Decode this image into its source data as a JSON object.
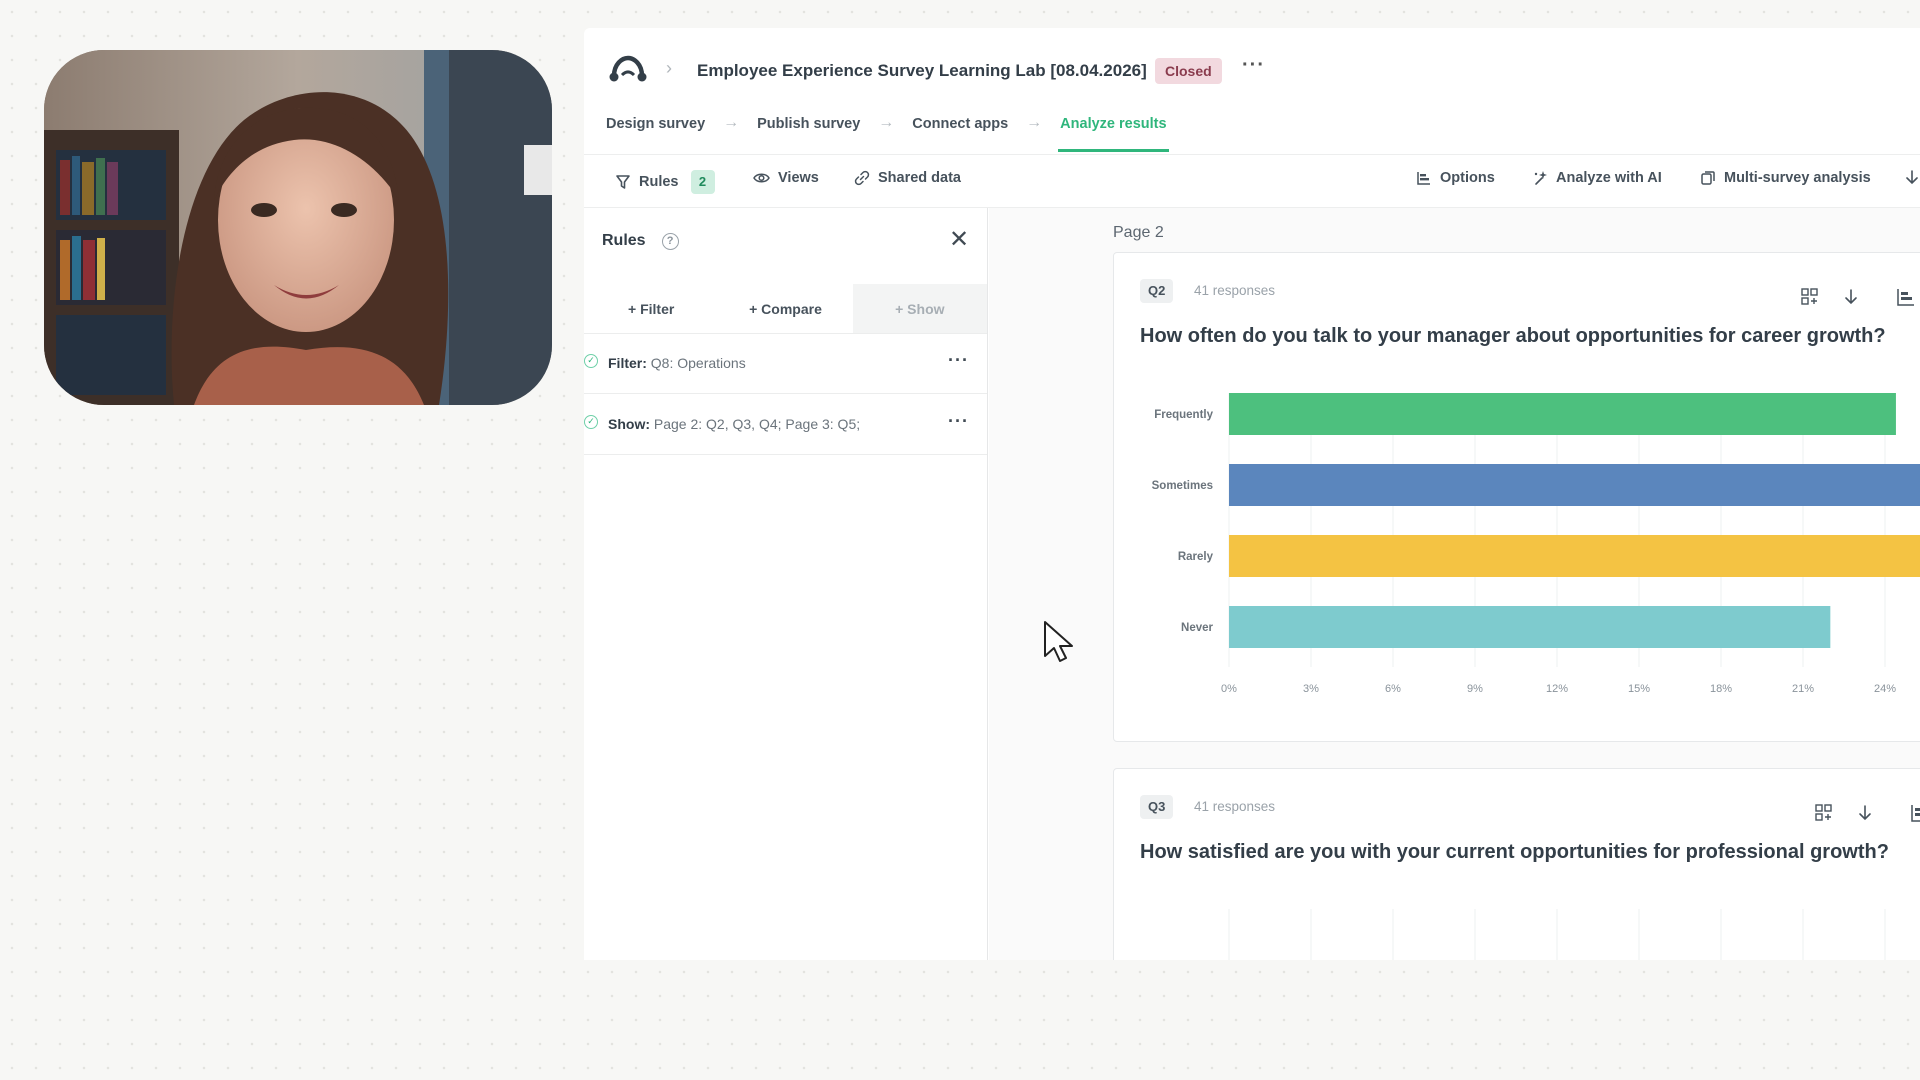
{
  "header": {
    "survey_title": "Employee Experience Survey Learning Lab [08.04.2026]",
    "status": "Closed",
    "more": "···"
  },
  "steps": [
    {
      "label": "Design survey",
      "active": false
    },
    {
      "label": "Publish survey",
      "active": false
    },
    {
      "label": "Connect apps",
      "active": false
    },
    {
      "label": "Analyze results",
      "active": true
    }
  ],
  "toolbar": {
    "rules_label": "Rules",
    "rules_count": "2",
    "views_label": "Views",
    "shared_label": "Shared data",
    "options_label": "Options",
    "ai_label": "Analyze with AI",
    "multi_label": "Multi-survey analysis"
  },
  "rules_panel": {
    "title": "Rules",
    "help": "?",
    "close": "✕",
    "tabs": [
      "+ Filter",
      "+ Compare",
      "+ Show"
    ],
    "rules": [
      {
        "kind": "Filter:",
        "value": "Q8: Operations"
      },
      {
        "kind": "Show:",
        "value": "Page 2: Q2, Q3, Q4; Page 3: Q5;"
      }
    ],
    "more": "···"
  },
  "results": {
    "page_label": "Page 2",
    "questions": [
      {
        "tag": "Q2",
        "responses": "41 responses",
        "title": "How often do you talk to your manager about opportunities for career growth?"
      },
      {
        "tag": "Q3",
        "responses": "41 responses",
        "title": "How satisfied are you with your current opportunities for professional growth?"
      }
    ]
  },
  "chart_data": {
    "type": "bar",
    "orientation": "horizontal",
    "categories": [
      "Frequently",
      "Sometimes",
      "Rarely",
      "Never"
    ],
    "values": [
      24.4,
      26.8,
      26.8,
      22.0
    ],
    "colors": [
      "#4dc07e",
      "#5b86bd",
      "#f4c343",
      "#7ecbce"
    ],
    "xlim": [
      0,
      24
    ],
    "x_ticks": [
      "0%",
      "3%",
      "6%",
      "9%",
      "12%",
      "15%",
      "18%",
      "21%",
      "24%"
    ],
    "grid": true,
    "title": "",
    "xlabel": "",
    "ylabel": ""
  },
  "icons": [
    "surveymonkey-logo-icon",
    "chevron-right-icon",
    "filter-icon",
    "eye-icon",
    "link-icon",
    "options-icon",
    "sparkle-icon",
    "copy-icon",
    "download-icon",
    "chart-type-icon",
    "grid-add-icon",
    "help-icon",
    "close-icon",
    "check-circle-icon",
    "cursor-arrow-icon"
  ]
}
